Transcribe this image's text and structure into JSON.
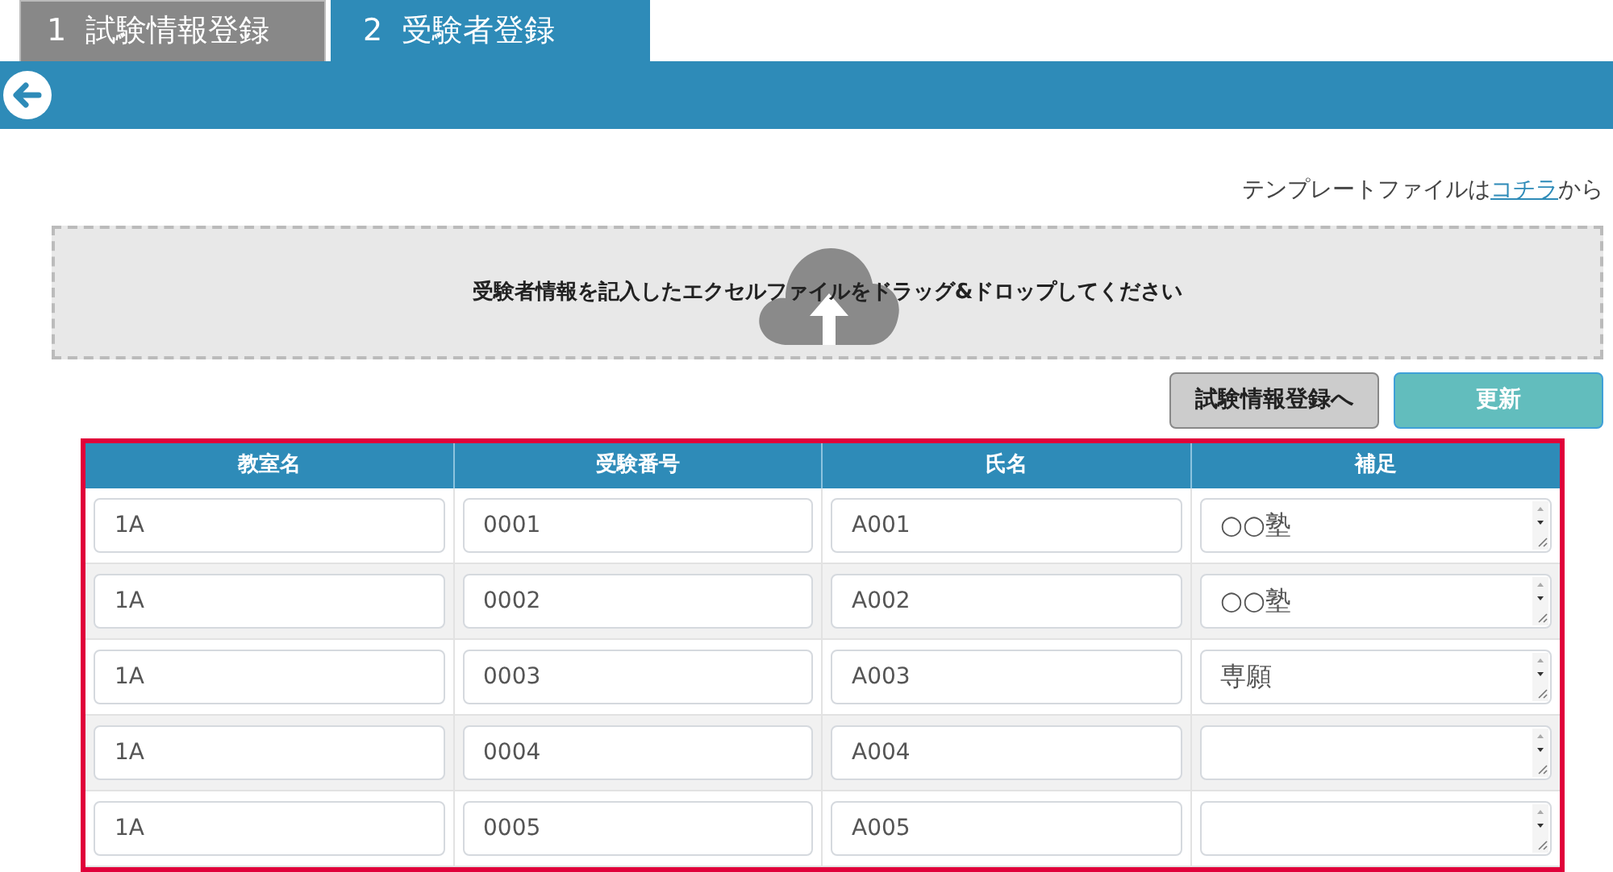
{
  "tabs": [
    {
      "label": "1  試験情報登録",
      "selected": false
    },
    {
      "label": "2  受験者登録",
      "selected": true
    }
  ],
  "template_note": {
    "before": "テンプレートファイルは",
    "link": "コチラ",
    "after": "から"
  },
  "drop_zone": {
    "text": "受験者情報を記入したエクセルファイルをドラッグ&ドロップしてください"
  },
  "buttons": [
    {
      "label": "試験情報登録へ",
      "kind": "secondary"
    },
    {
      "label": "更新",
      "kind": "primary"
    }
  ],
  "table": {
    "columns": [
      "教室名",
      "受験番号",
      "氏名",
      "補足"
    ],
    "rows": [
      {
        "room": "1A",
        "number": "0001",
        "name": "A001",
        "remark": "○○塾"
      },
      {
        "room": "1A",
        "number": "0002",
        "name": "A002",
        "remark": "○○塾"
      },
      {
        "room": "1A",
        "number": "0003",
        "name": "A003",
        "remark": "専願"
      },
      {
        "room": "1A",
        "number": "0004",
        "name": "A004"
      },
      {
        "room": "1A",
        "number": "0005",
        "name": "A005"
      }
    ]
  }
}
